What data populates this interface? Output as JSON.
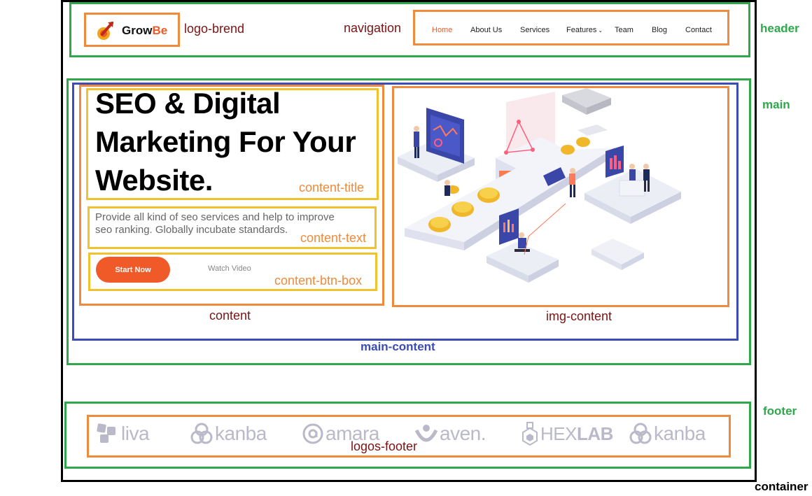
{
  "annotations": {
    "header": "header",
    "main": "main",
    "footer": "footer",
    "container": "container",
    "logo_brand": "logo-brend",
    "navigation": "navigation",
    "content_title": "content-title",
    "content_text": "content-text",
    "content_btn_box": "content-btn-box",
    "content": "content",
    "img_content": "img-content",
    "main_content": "main-content",
    "logos_footer": "logos-footer"
  },
  "brand": {
    "name_part1": "Grow",
    "name_part2": "Be",
    "accent_color": "#f05a28"
  },
  "nav": {
    "items": [
      {
        "label": "Home",
        "active": true
      },
      {
        "label": "About Us"
      },
      {
        "label": "Services"
      },
      {
        "label": "Features",
        "has_dropdown": true
      },
      {
        "label": "Team"
      },
      {
        "label": "Blog"
      },
      {
        "label": "Contact"
      }
    ]
  },
  "hero": {
    "title_line1": "SEO & Digital",
    "title_line2": "Marketing For Your",
    "title_line3": "Website.",
    "text_line1": "Provide all kind of seo services and help to improve",
    "text_line2": "seo ranking. Globally incubate standards.",
    "start_label": "Start Now",
    "video_label": "Watch Video"
  },
  "footer_logos": [
    {
      "name": "liva",
      "icon": "liva-icon"
    },
    {
      "name": "kanba",
      "icon": "kanba-icon"
    },
    {
      "name": "amara",
      "icon": "amara-icon"
    },
    {
      "name": "aven.",
      "icon": "aven-icon"
    },
    {
      "name": "HEX",
      "name_bold": "LAB",
      "icon": "hexlab-icon"
    },
    {
      "name": "kanba",
      "icon": "kanba-icon"
    }
  ],
  "colors": {
    "green": "#2ea84a",
    "orange": "#f08a3c",
    "blue": "#3b4bb8",
    "yellow": "#f2c12e",
    "label_dark": "#7a1414"
  }
}
